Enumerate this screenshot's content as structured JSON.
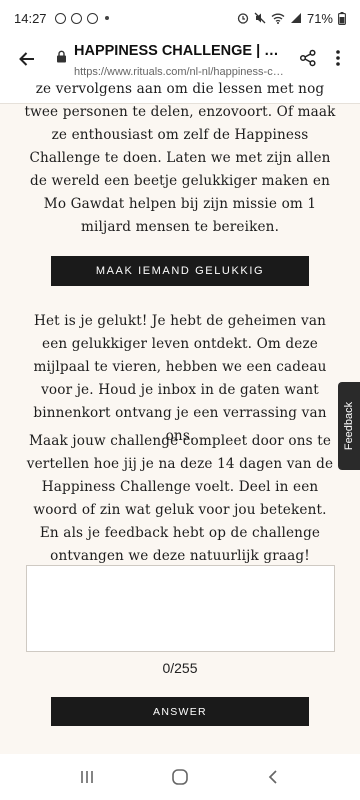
{
  "status_bar": {
    "time": "14:27",
    "battery": "71%"
  },
  "browser": {
    "title": "HAPPINESS CHALLENGE | RITUA...",
    "url": "https://www.rituals.com/nl-nl/happiness-chall..."
  },
  "content": {
    "paragraph_1": "ze vervolgens aan om die lessen met nog twee personen te delen, enzovoort. Of maak ze enthousiast om zelf de Happiness Challenge te doen. Laten we met zijn allen de wereld een beetje gelukkiger maken en Mo Gawdat helpen bij zijn missie om 1 miljard mensen te bereiken.",
    "cta_label": "MAAK IEMAND GELUKKIG",
    "paragraph_2": "Het is je gelukt! Je hebt de geheimen van een gelukkiger leven ontdekt. Om deze mijlpaal te vieren, hebben we een cadeau voor je. Houd je inbox in de gaten want binnenkort ontvang je een verrassing van ons.",
    "paragraph_3": "Maak jouw challenge compleet door ons te vertellen hoe jij je na deze 14 dagen van de Happiness Challenge voelt. Deel in een woord of zin wat geluk voor jou betekent. En als je feedback hebt op de challenge ontvangen we deze natuurlijk graag!",
    "textarea_value": "",
    "char_counter": "0/255",
    "answer_label": "ANSWER"
  },
  "feedback_tab": "Feedback",
  "icons": {
    "back": "arrow-left-icon",
    "lock": "lock-icon",
    "share": "share-icon",
    "menu": "more-vert-icon",
    "nav_recents": "recents-icon",
    "nav_home": "home-icon",
    "nav_back": "nav-back-icon"
  }
}
